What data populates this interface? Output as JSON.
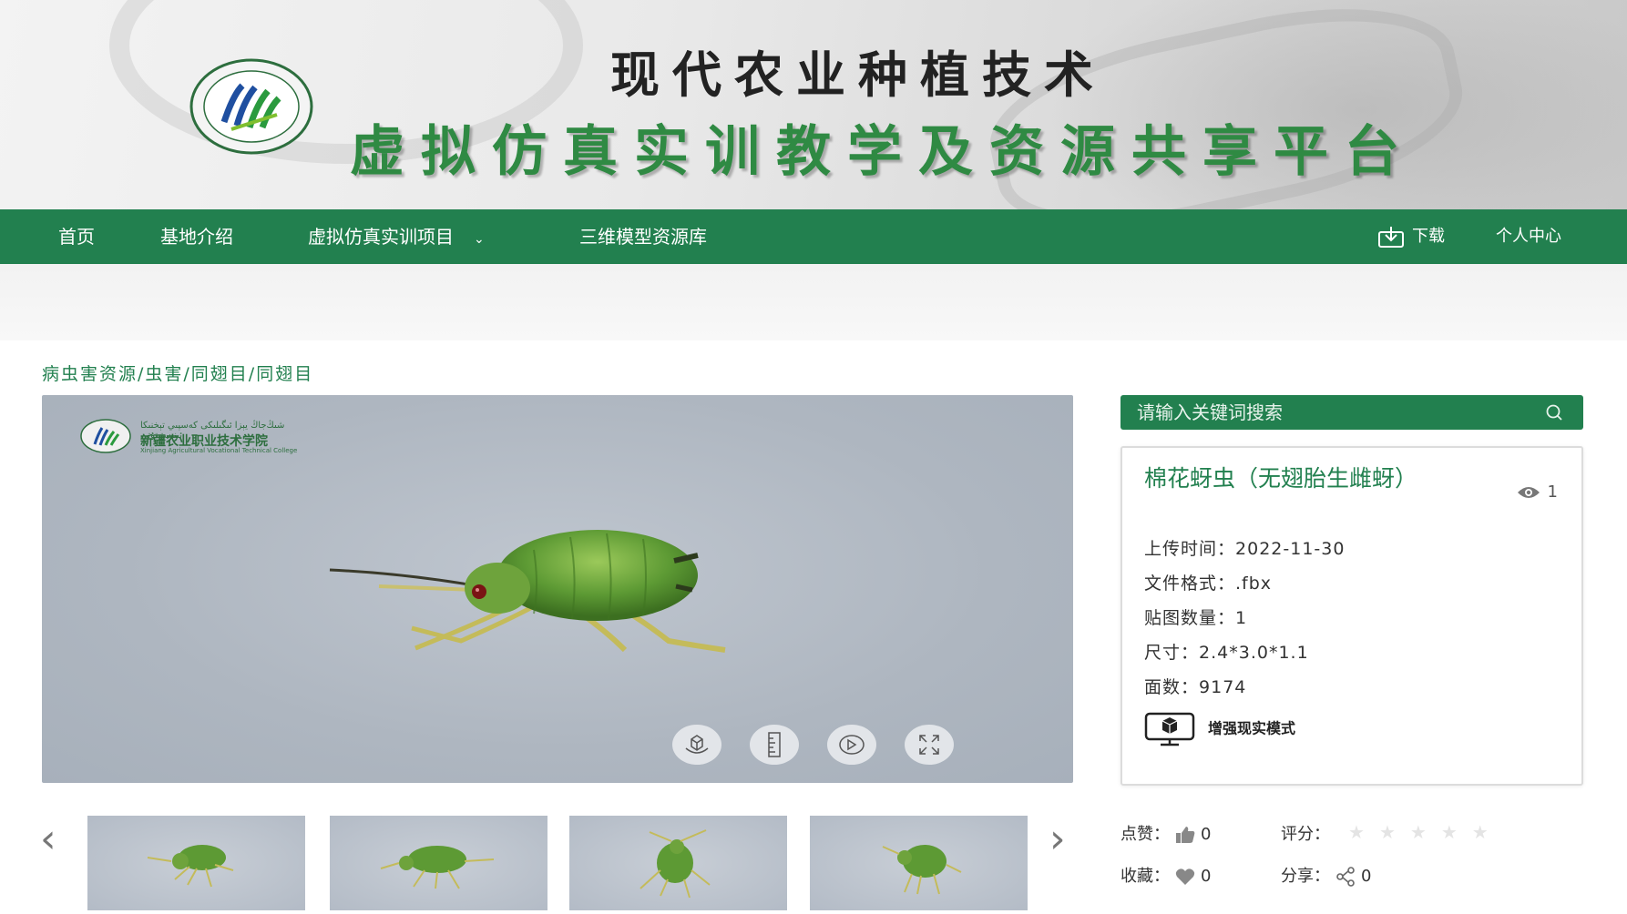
{
  "header": {
    "logo_icon": "college-logo",
    "title_line1": "现代农业种植技术",
    "title_line2": "虚拟仿真实训教学及资源共享平台"
  },
  "nav": {
    "items": [
      "首页",
      "基地介绍",
      "虚拟仿真实训项目",
      "三维模型资源库"
    ],
    "dropdown_icon": "chevron-down-icon",
    "download_label": "下载",
    "personal_center_label": "个人中心"
  },
  "breadcrumb": "病虫害资源/虫害/同翅目/同翅目",
  "viewer": {
    "watermark_line1": "ﺷﯩﯔﺟﺎڭ ﻳﯧﺰا ﺋﯩﮕﯩﻠﯩﻜﻰ ﻛﻪﺳﭙﯩﻲ ﺗﯧﺨﻨﯩﻜﺎ ﺋﯩﻨﯩﺴﺘﯩﺘﯘﺗﻰ",
    "watermark_line2": "新疆农业职业技术学院",
    "watermark_line3": "Xinjiang Agricultural Vocational Technical College",
    "controls": [
      "rotate-360-icon",
      "measure-ruler-icon",
      "auto-rotate-icon",
      "fullscreen-icon"
    ]
  },
  "thumbnails": {
    "prev_icon": "chevron-left-icon",
    "next_icon": "chevron-right-icon",
    "count": 4
  },
  "search": {
    "placeholder": "请输入关键词搜索",
    "icon": "search-icon"
  },
  "model": {
    "title": "棉花蚜虫（无翅胎生雌蚜）",
    "views": "1",
    "upload_label": "上传时间：",
    "upload_value": "2022-11-30",
    "format_label": "文件格式：",
    "format_value": ".fbx",
    "texture_label": "贴图数量：",
    "texture_value": "1",
    "size_label": "尺寸：",
    "size_value": "2.4*3.0*1.1",
    "faces_label": "面数：",
    "faces_value": "9174",
    "ar_label": "增强现实模式"
  },
  "stats": {
    "likes_label": "点赞：",
    "likes_value": "0",
    "rating_label": "评分：",
    "rating_value": 0,
    "rating_max": 5,
    "favorites_label": "收藏：",
    "favorites_value": "0",
    "share_label": "分享：",
    "share_value": "0"
  },
  "colors": {
    "brand_green": "#22804f",
    "viewer_bg": "#aeb6c0"
  }
}
